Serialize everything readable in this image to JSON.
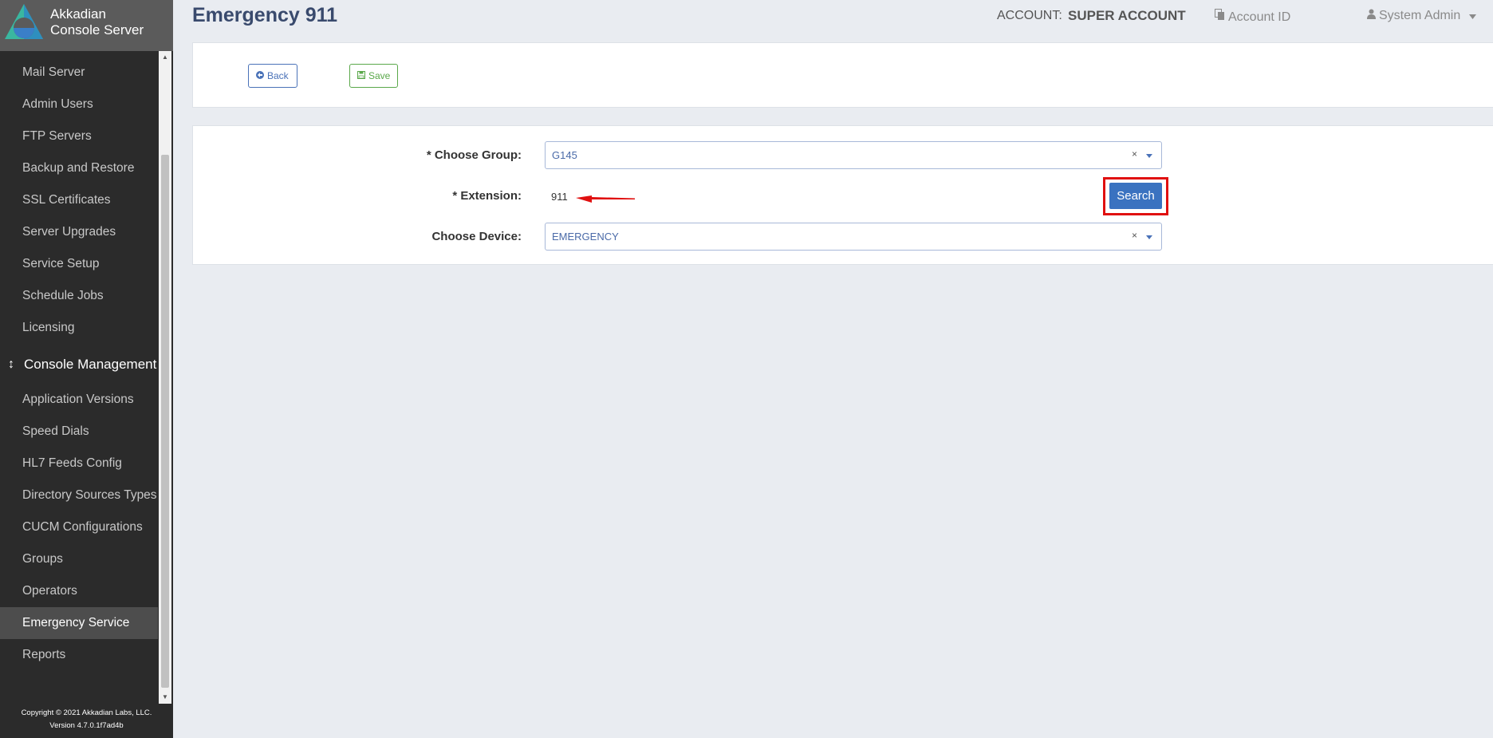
{
  "app": {
    "name_line1": "Akkadian",
    "name_line2": "Console Server"
  },
  "header": {
    "page_title": "Emergency 911",
    "account_label": "ACCOUNT:",
    "account_value": "SUPER ACCOUNT",
    "account_id": "Account ID",
    "user": "System Admin"
  },
  "sidebar": {
    "items": [
      {
        "label": "Mail Server"
      },
      {
        "label": "Admin Users"
      },
      {
        "label": "FTP Servers"
      },
      {
        "label": "Backup and Restore"
      },
      {
        "label": "SSL Certificates"
      },
      {
        "label": "Server Upgrades"
      },
      {
        "label": "Service Setup"
      },
      {
        "label": "Schedule Jobs"
      },
      {
        "label": "Licensing"
      }
    ],
    "section_header": "Console Management",
    "section_items": [
      {
        "label": "Application Versions"
      },
      {
        "label": "Speed Dials"
      },
      {
        "label": "HL7 Feeds Config"
      },
      {
        "label": "Directory Sources Types"
      },
      {
        "label": "CUCM Configurations"
      },
      {
        "label": "Groups"
      },
      {
        "label": "Operators"
      },
      {
        "label": "Emergency Service",
        "active": true
      },
      {
        "label": "Reports"
      }
    ],
    "copyright_line1": "Copyright © 2021 Akkadian Labs, LLC.",
    "copyright_line2": "Version 4.7.0.1f7ad4b"
  },
  "toolbar": {
    "back_label": "Back",
    "save_label": "Save"
  },
  "form": {
    "group_label": "* Choose Group:",
    "group_value": "G145",
    "extension_label": "* Extension:",
    "extension_value": "911",
    "search_label": "Search",
    "device_label": "Choose Device:",
    "device_value": "EMERGENCY",
    "clear_glyph": "×"
  },
  "colors": {
    "sidebar_bg": "#2b2b2b",
    "brand_bg": "#5b5b5b",
    "title": "#394a6d",
    "primary": "#3a72c0",
    "annotation": "#e01010"
  }
}
